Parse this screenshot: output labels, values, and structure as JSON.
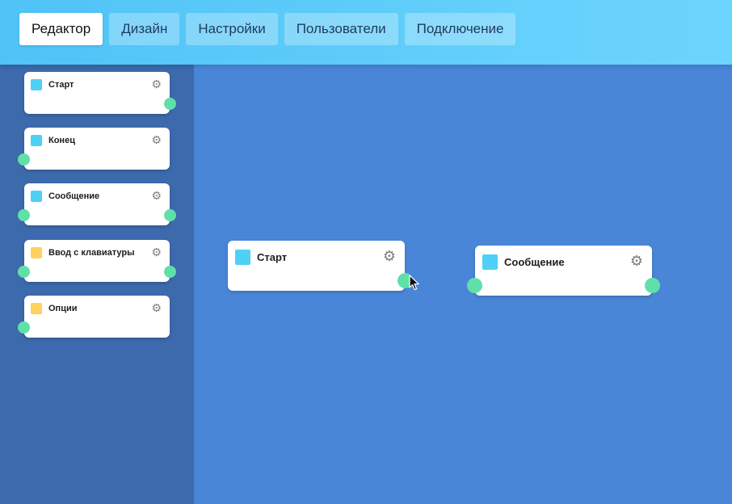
{
  "tabs": [
    {
      "label": "Редактор",
      "active": true
    },
    {
      "label": "Дизайн"
    },
    {
      "label": "Настройки"
    },
    {
      "label": "Пользователи"
    },
    {
      "label": "Подключение"
    }
  ],
  "palette": [
    {
      "label": "Старт",
      "color": "#4fd0f5",
      "ports": [
        "out"
      ]
    },
    {
      "label": "Конец",
      "color": "#4fd0f5",
      "ports": [
        "in"
      ]
    },
    {
      "label": "Сообщение",
      "color": "#4fd0f5",
      "ports": [
        "in",
        "out"
      ]
    },
    {
      "label": "Ввод с клавиатуры",
      "color": "#ffd15e",
      "ports": [
        "in",
        "out"
      ]
    },
    {
      "label": "Опции",
      "color": "#ffd15e",
      "ports": [
        "in"
      ]
    }
  ],
  "canvas_nodes": [
    {
      "label": "Старт",
      "color": "#4fd0f5",
      "ports": [
        "out"
      ]
    },
    {
      "label": "Сообщение",
      "color": "#4fd0f5",
      "ports": [
        "in",
        "out"
      ]
    }
  ],
  "icons": {
    "settings": "gear-icon",
    "cursor": "mouse-pointer-icon"
  },
  "colors": {
    "topbar": "#5fd0fa",
    "sidebar": "#3c6aad",
    "canvas": "#4a86d8",
    "port": "#5fe0a8",
    "block_blue": "#4fd0f5",
    "block_yellow": "#ffd15e"
  }
}
